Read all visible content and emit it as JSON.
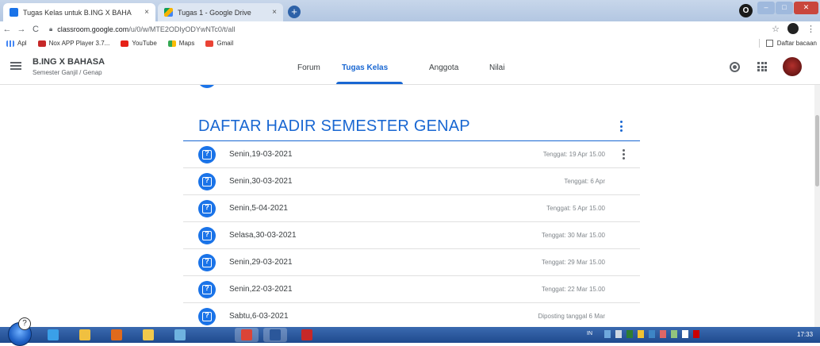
{
  "browser": {
    "tabs": [
      {
        "title": "Tugas Kelas untuk B.ING X BAHA",
        "favicon": "classroom-icon",
        "color": "#1a73e8"
      },
      {
        "title": "Tugas 1 - Google Drive",
        "favicon": "drive-icon",
        "color": "#f4b400"
      }
    ],
    "tab_close": "×",
    "new_tab": "+",
    "address": {
      "host": "classroom.google.com",
      "path": "/u/0/w/MTE2ODIyODYwNTc0/t/all"
    },
    "bookmarks": [
      {
        "label": "Apl",
        "icon": "apps-grid-icon",
        "color": "#5f6368"
      },
      {
        "label": "Nox APP Player 3.7...",
        "icon": "nox-icon",
        "color": "#c62828"
      },
      {
        "label": "YouTube",
        "icon": "youtube-icon",
        "color": "#e62117"
      },
      {
        "label": "Maps",
        "icon": "maps-icon",
        "color": "#34a853"
      },
      {
        "label": "Gmail",
        "icon": "gmail-icon",
        "color": "#ea4335"
      }
    ],
    "reading_list": "Daftar bacaan"
  },
  "header": {
    "class_name": "B.ING X BAHASA",
    "class_section": "Semester Ganjil / Genap",
    "tabs": [
      {
        "label": "Forum",
        "active": false
      },
      {
        "label": "Tugas Kelas",
        "active": true
      },
      {
        "label": "Anggota",
        "active": false
      },
      {
        "label": "Nilai",
        "active": false
      }
    ],
    "accent": "#1967d2"
  },
  "topic": {
    "title": "DAFTAR HADIR SEMESTER GENAP"
  },
  "assignments": [
    {
      "title": "Senin,19-03-2021",
      "due": "Tenggat: 19 Apr 15.00",
      "menu": true
    },
    {
      "title": "Senin,30-03-2021",
      "due": "Tenggat: 6 Apr",
      "menu": false
    },
    {
      "title": "Senin,5-04-2021",
      "due": "Tenggat: 5 Apr 15.00",
      "menu": false
    },
    {
      "title": "Selasa,30-03-2021",
      "due": "Tenggat: 30 Mar 15.00",
      "menu": false
    },
    {
      "title": "Senin,29-03-2021",
      "due": "Tenggat: 29 Mar 15.00",
      "menu": false
    },
    {
      "title": "Senin,22-03-2021",
      "due": "Tenggat: 22 Mar 15.00",
      "menu": false
    },
    {
      "title": "Sabtu,6-03-2021",
      "due": "Diposting tanggal 6 Mar",
      "menu": false
    }
  ],
  "taskbar": {
    "language": "IN",
    "clock": "17:33",
    "apps": [
      {
        "icon": "ie-icon",
        "color": "#3aa0e8"
      },
      {
        "icon": "explorer-icon",
        "color": "#f0c040"
      },
      {
        "icon": "media-icon",
        "color": "#e06a1c"
      },
      {
        "icon": "folder-icon",
        "color": "#f2c94c"
      },
      {
        "icon": "network-icon",
        "color": "#6fb3e0"
      },
      {
        "icon": "chrome-icon",
        "color": "#db4437",
        "active": true
      },
      {
        "icon": "word-icon",
        "color": "#2b579a",
        "active": true
      },
      {
        "icon": "mcafee-icon",
        "color": "#c62828"
      }
    ]
  }
}
